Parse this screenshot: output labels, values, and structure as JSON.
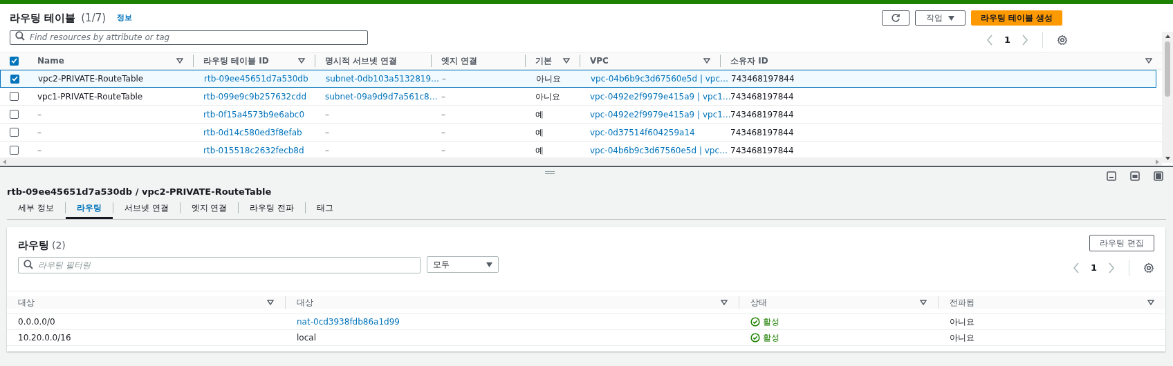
{
  "list": {
    "title": "라우팅 테이블",
    "count": "(1/7)",
    "info": "정보",
    "search": {
      "placeholder": "Find resources by attribute or tag"
    },
    "actions": "작업",
    "create": "라우팅 테이블 생성",
    "page": "1",
    "header_checkbox": {
      "checked": true
    },
    "columns": [
      {
        "label": "Name",
        "sortable": true
      },
      {
        "label": "라우팅 테이블 ID",
        "sortable": true
      },
      {
        "label": "명시적 서브넷 연결",
        "sortable": false
      },
      {
        "label": "엣지 연결",
        "sortable": false
      },
      {
        "label": "기본",
        "sortable": true
      },
      {
        "label": "VPC",
        "sortable": true
      },
      {
        "label": "소유자 ID",
        "sortable": true
      }
    ],
    "rows": [
      {
        "selected": true,
        "cells": [
          {
            "text": "vpc2-PRIVATE-RouteTable",
            "kind": "text"
          },
          {
            "text": "rtb-09ee45651d7a530db",
            "kind": "link"
          },
          {
            "text": "subnet-0db103a5132819…",
            "kind": "link"
          },
          {
            "text": "–",
            "kind": "empty"
          },
          {
            "text": "아니요",
            "kind": "text"
          },
          {
            "text": "vpc-04b6b9c3d67560e5d | vpc…",
            "kind": "link"
          },
          {
            "text": "743468197844",
            "kind": "text"
          }
        ]
      },
      {
        "selected": false,
        "cells": [
          {
            "text": "vpc1-PRIVATE-RouteTable",
            "kind": "text"
          },
          {
            "text": "rtb-099e9c9b257632cdd",
            "kind": "link"
          },
          {
            "text": "subnet-09a9d9d7a561c8…",
            "kind": "link"
          },
          {
            "text": "–",
            "kind": "empty"
          },
          {
            "text": "아니요",
            "kind": "text"
          },
          {
            "text": "vpc-0492e2f9979e415a9 | vpc1…",
            "kind": "link"
          },
          {
            "text": "743468197844",
            "kind": "text"
          }
        ]
      },
      {
        "selected": false,
        "cells": [
          {
            "text": "–",
            "kind": "empty"
          },
          {
            "text": "rtb-0f15a4573b9e6abc0",
            "kind": "link"
          },
          {
            "text": "–",
            "kind": "empty"
          },
          {
            "text": "–",
            "kind": "empty"
          },
          {
            "text": "예",
            "kind": "text"
          },
          {
            "text": "vpc-0492e2f9979e415a9 | vpc1…",
            "kind": "link"
          },
          {
            "text": "743468197844",
            "kind": "text"
          }
        ]
      },
      {
        "selected": false,
        "cells": [
          {
            "text": "–",
            "kind": "empty"
          },
          {
            "text": "rtb-0d14c580ed3f8efab",
            "kind": "link"
          },
          {
            "text": "–",
            "kind": "empty"
          },
          {
            "text": "–",
            "kind": "empty"
          },
          {
            "text": "예",
            "kind": "text"
          },
          {
            "text": "vpc-0d37514f604259a14",
            "kind": "link"
          },
          {
            "text": "743468197844",
            "kind": "text"
          }
        ]
      },
      {
        "selected": false,
        "cells": [
          {
            "text": "–",
            "kind": "empty"
          },
          {
            "text": "rtb-015518c2632fecb8d",
            "kind": "link"
          },
          {
            "text": "–",
            "kind": "empty"
          },
          {
            "text": "–",
            "kind": "empty"
          },
          {
            "text": "예",
            "kind": "text"
          },
          {
            "text": "vpc-04b6b9c3d67560e5d | vpc…",
            "kind": "link"
          },
          {
            "text": "743468197844",
            "kind": "text"
          }
        ]
      }
    ]
  },
  "detail": {
    "title": "rtb-09ee45651d7a530db / vpc2-PRIVATE-RouteTable",
    "tabs": [
      {
        "label": "세부 정보",
        "selected": false
      },
      {
        "label": "라우팅",
        "selected": true
      },
      {
        "label": "서브넷 연결",
        "selected": false
      },
      {
        "label": "엣지 연결",
        "selected": false
      },
      {
        "label": "라우팅 전파",
        "selected": false
      },
      {
        "label": "태그",
        "selected": false
      }
    ],
    "routes": {
      "title": "라우팅",
      "count": "(2)",
      "edit": "라우팅 편집",
      "filter": {
        "placeholder": "라우팅 필터링"
      },
      "select": "모두",
      "page": "1",
      "columns": [
        {
          "label": "대상",
          "sortable": true
        },
        {
          "label": "대상",
          "sortable": true
        },
        {
          "label": "상태",
          "sortable": true
        },
        {
          "label": "전파됨",
          "sortable": true
        }
      ],
      "rows": [
        {
          "cells": [
            {
              "text": "0.0.0.0/0",
              "kind": "text"
            },
            {
              "text": "nat-0cd3938fdb86a1d99",
              "kind": "link"
            },
            {
              "text": "활성",
              "kind": "status"
            },
            {
              "text": "아니요",
              "kind": "text"
            }
          ]
        },
        {
          "cells": [
            {
              "text": "10.20.0.0/16",
              "kind": "text"
            },
            {
              "text": "local",
              "kind": "text"
            },
            {
              "text": "활성",
              "kind": "status"
            },
            {
              "text": "아니요",
              "kind": "text"
            }
          ]
        }
      ]
    }
  }
}
